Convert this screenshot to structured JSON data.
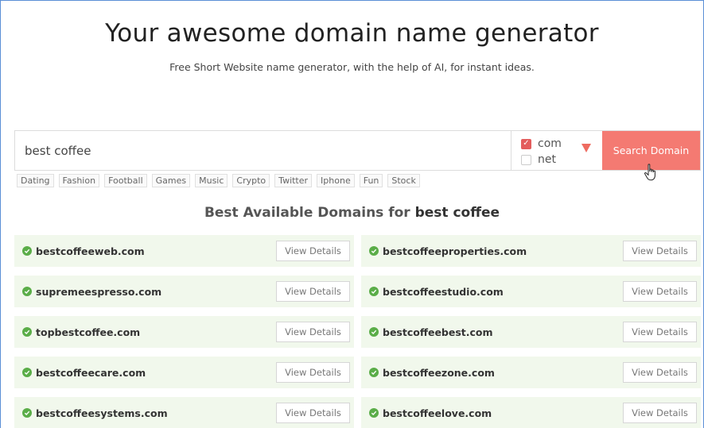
{
  "header": {
    "title": "Your awesome domain name generator",
    "subtitle": "Free Short Website name generator, with the help of AI, for instant ideas."
  },
  "search": {
    "value": "best coffee",
    "button_label": "Search Domain",
    "extensions": [
      {
        "label": "com",
        "checked": true
      },
      {
        "label": "net",
        "checked": false
      }
    ]
  },
  "tags": [
    "Dating",
    "Fashion",
    "Football",
    "Games",
    "Music",
    "Crypto",
    "Twitter",
    "Iphone",
    "Fun",
    "Stock"
  ],
  "results": {
    "title_prefix": "Best Available Domains for",
    "title_query": "best coffee",
    "details_label": "View Details",
    "domains": [
      "bestcoffeeweb.com",
      "bestcoffeeproperties.com",
      "supremeespresso.com",
      "bestcoffeestudio.com",
      "topbestcoffee.com",
      "bestcoffeebest.com",
      "bestcoffeecare.com",
      "bestcoffeezone.com",
      "bestcoffeesystems.com",
      "bestcoffeelove.com"
    ]
  },
  "colors": {
    "accent": "#f47a72",
    "check_green": "#5aad48",
    "card_bg": "#f1f8ec"
  }
}
